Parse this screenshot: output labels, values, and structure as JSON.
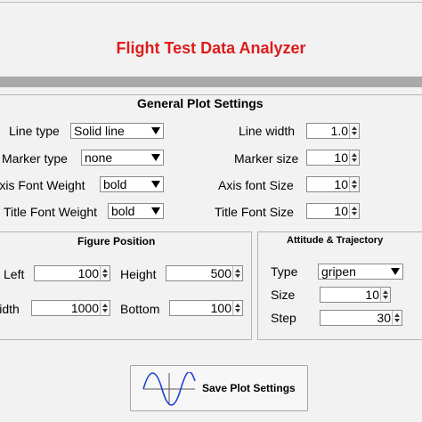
{
  "app": {
    "title": "Flight Test Data Analyzer"
  },
  "general": {
    "title": "General Plot Settings",
    "line_type": {
      "label": "Line type",
      "value": "Solid line"
    },
    "marker_type": {
      "label": "Marker type",
      "value": "none"
    },
    "axis_font_weight": {
      "label": "Axis Font Weight",
      "value": "bold"
    },
    "title_font_weight": {
      "label": "Title Font Weight",
      "value": "bold"
    },
    "line_width": {
      "label": "Line width",
      "value": "1.0"
    },
    "marker_size": {
      "label": "Marker size",
      "value": "10"
    },
    "axis_font_size": {
      "label": "Axis font Size",
      "value": "10"
    },
    "title_font_size": {
      "label": "Title Font Size",
      "value": "10"
    }
  },
  "figure_position": {
    "title": "Figure Position",
    "left": {
      "label": "Left",
      "value": "100"
    },
    "height": {
      "label": "Height",
      "value": "500"
    },
    "width": {
      "label": "Width",
      "value": "1000"
    },
    "bottom": {
      "label": "Bottom",
      "value": "100"
    }
  },
  "attitude": {
    "title": "Attitude & Trajectory",
    "type": {
      "label": "Type",
      "value": "gripen"
    },
    "size": {
      "label": "Size",
      "value": "10"
    },
    "step": {
      "label": "Step",
      "value": "30"
    }
  },
  "save_button": {
    "label": "Save Plot Settings",
    "icon": "sine-wave-icon"
  }
}
